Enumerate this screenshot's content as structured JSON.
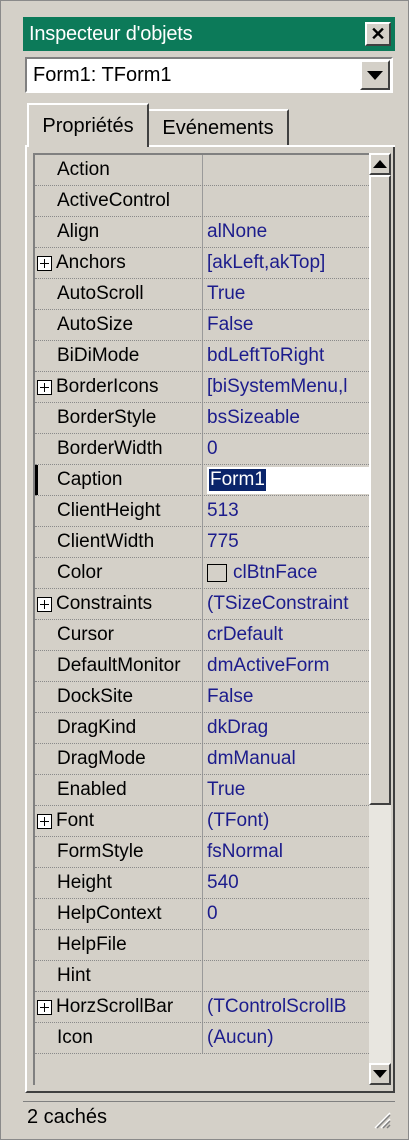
{
  "window": {
    "title": "Inspecteur d'objets",
    "close_icon": "close-x-icon",
    "title_bar_color": "#0c7a59"
  },
  "object_selector": {
    "value": "Form1: TForm1",
    "dropdown_icon": "chevron-down-icon"
  },
  "tabs": [
    {
      "label": "Propriétés",
      "active": true
    },
    {
      "label": "Evénements",
      "active": false
    }
  ],
  "properties": [
    {
      "name": "Action",
      "value": "",
      "expandable": false
    },
    {
      "name": "ActiveControl",
      "value": "",
      "expandable": false
    },
    {
      "name": "Align",
      "value": "alNone",
      "expandable": false
    },
    {
      "name": "Anchors",
      "value": "[akLeft,akTop]",
      "expandable": true
    },
    {
      "name": "AutoScroll",
      "value": "True",
      "expandable": false
    },
    {
      "name": "AutoSize",
      "value": "False",
      "expandable": false
    },
    {
      "name": "BiDiMode",
      "value": "bdLeftToRight",
      "expandable": false
    },
    {
      "name": "BorderIcons",
      "value": "[biSystemMenu,l",
      "expandable": true
    },
    {
      "name": "BorderStyle",
      "value": "bsSizeable",
      "expandable": false
    },
    {
      "name": "BorderWidth",
      "value": "0",
      "expandable": false
    },
    {
      "name": "Caption",
      "value": "Form1",
      "expandable": false,
      "selected": true
    },
    {
      "name": "ClientHeight",
      "value": "513",
      "expandable": false
    },
    {
      "name": "ClientWidth",
      "value": "775",
      "expandable": false
    },
    {
      "name": "Color",
      "value": "clBtnFace",
      "expandable": false,
      "swatch": true
    },
    {
      "name": "Constraints",
      "value": "(TSizeConstraint",
      "expandable": true
    },
    {
      "name": "Cursor",
      "value": "crDefault",
      "expandable": false
    },
    {
      "name": "DefaultMonitor",
      "value": "dmActiveForm",
      "expandable": false
    },
    {
      "name": "DockSite",
      "value": "False",
      "expandable": false
    },
    {
      "name": "DragKind",
      "value": "dkDrag",
      "expandable": false
    },
    {
      "name": "DragMode",
      "value": "dmManual",
      "expandable": false
    },
    {
      "name": "Enabled",
      "value": "True",
      "expandable": false
    },
    {
      "name": "Font",
      "value": "(TFont)",
      "expandable": true
    },
    {
      "name": "FormStyle",
      "value": "fsNormal",
      "expandable": false
    },
    {
      "name": "Height",
      "value": "540",
      "expandable": false
    },
    {
      "name": "HelpContext",
      "value": "0",
      "expandable": false
    },
    {
      "name": "HelpFile",
      "value": "",
      "expandable": false
    },
    {
      "name": "Hint",
      "value": "",
      "expandable": false
    },
    {
      "name": "HorzScrollBar",
      "value": "(TControlScrollB",
      "expandable": true
    },
    {
      "name": "Icon",
      "value": "(Aucun)",
      "expandable": false
    }
  ],
  "status": {
    "text": "2 cachés",
    "grip_icon": "resize-grip-icon"
  },
  "colors": {
    "value_text": "#1c1c8c",
    "selection": "#0a246a",
    "face": "#d4d0c8"
  }
}
